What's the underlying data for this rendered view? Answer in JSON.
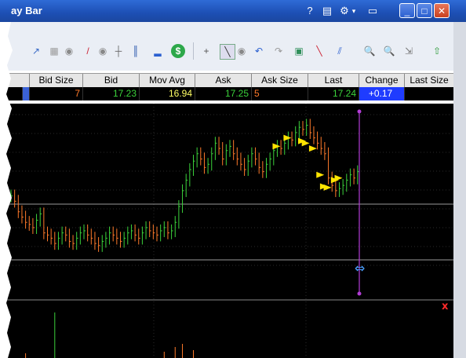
{
  "window": {
    "title": "ay Bar"
  },
  "quote": {
    "headers": [
      "Bid Size",
      "Bid",
      "Mov Avg",
      "Ask",
      "Ask Size",
      "Last",
      "Change",
      "Last Size"
    ],
    "values": {
      "bid_size": "7",
      "bid": "17.23",
      "mov_avg": "16.94",
      "ask": "17.25",
      "ask_size": "5",
      "last": "17.24",
      "change": "+0.17",
      "last_size": ""
    }
  },
  "colors": {
    "up": "#3bd23b",
    "down": "#ff7a2a",
    "marker": "#ffe400",
    "cursor": "#b23cd6",
    "change_bg": "#1f3cff",
    "mov_avg": "#ffff66"
  },
  "icons": [
    "help-icon",
    "print-icon",
    "settings-icon",
    "dropdown-icon",
    "display-icon",
    "minimize-icon",
    "maximize-icon",
    "close-icon",
    "trendline-icon",
    "bar-chart-icon",
    "circle-icon",
    "pencil-icon",
    "ohlc-icon",
    "candle-icon",
    "volume-icon",
    "currency-icon",
    "crosshair-icon",
    "select-icon",
    "undo-icon",
    "redo-icon",
    "save-icon",
    "line-tool-icon",
    "parallel-tool-icon",
    "zoom-in-icon",
    "zoom-out-icon",
    "fit-icon",
    "refresh-icon"
  ],
  "chart_data": {
    "type": "ohlc",
    "series_close": [
      16.95,
      16.9,
      16.8,
      16.75,
      16.7,
      16.68,
      16.65,
      16.72,
      16.78,
      16.6,
      16.58,
      16.55,
      16.5,
      16.55,
      16.6,
      16.58,
      16.52,
      16.5,
      16.55,
      16.6,
      16.62,
      16.58,
      16.55,
      16.5,
      16.48,
      16.52,
      16.55,
      16.6,
      16.58,
      16.55,
      16.52,
      16.55,
      16.6,
      16.62,
      16.58,
      16.55,
      16.6,
      16.65,
      16.62,
      16.6,
      16.58,
      16.62,
      16.65,
      16.6,
      16.62,
      16.7,
      16.85,
      17.0,
      17.1,
      17.2,
      17.28,
      17.35,
      17.3,
      17.22,
      17.25,
      17.35,
      17.45,
      17.4,
      17.3,
      17.38,
      17.42,
      17.35,
      17.3,
      17.25,
      17.2,
      17.28,
      17.35,
      17.3,
      17.22,
      17.18,
      17.25,
      17.3,
      17.38,
      17.42,
      17.4,
      17.45,
      17.5,
      17.48,
      17.55,
      17.6,
      17.58,
      17.62,
      17.55,
      17.5,
      17.45,
      17.4,
      17.35,
      17.12,
      17.05,
      17.0,
      17.02,
      17.05,
      17.1,
      17.15,
      17.12,
      17.18
    ],
    "markers": [
      [
        73,
        17.42
      ],
      [
        76,
        17.5
      ],
      [
        80,
        17.47
      ],
      [
        81,
        17.45
      ],
      [
        83,
        17.4
      ],
      [
        85,
        17.15
      ],
      [
        86,
        17.04
      ],
      [
        87,
        17.03
      ],
      [
        89,
        17.1
      ],
      [
        90,
        17.12
      ]
    ]
  }
}
